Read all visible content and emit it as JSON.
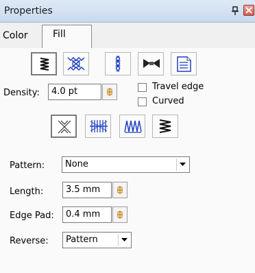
{
  "panel": {
    "title": "Properties",
    "pin_icon": "pin-icon",
    "close_icon": "close-icon"
  },
  "tabs": [
    {
      "label": "Color",
      "active": false
    },
    {
      "label": "Fill",
      "active": true
    }
  ],
  "fill_types": [
    {
      "name": "satin-fill-icon",
      "selected": true
    },
    {
      "name": "cross-pattern-fill-icon",
      "selected": false
    },
    {
      "name": "wave-fill-icon",
      "selected": false
    },
    {
      "name": "bow-tie-fill-icon",
      "selected": false
    },
    {
      "name": "document-fill-icon",
      "selected": false
    }
  ],
  "density": {
    "label": "Density:",
    "value": "4.0 pt"
  },
  "travel_edge": {
    "label": "Travel edge",
    "checked": false
  },
  "curved": {
    "label": "Curved",
    "checked": false
  },
  "stitch_styles": [
    {
      "name": "cross-stitch-icon",
      "selected": true
    },
    {
      "name": "blanket-stitch-icon",
      "selected": false
    },
    {
      "name": "zigzag-stitch-icon",
      "selected": false
    },
    {
      "name": "satin-stitch-icon",
      "selected": false
    }
  ],
  "pattern": {
    "label": "Pattern:",
    "value": "None"
  },
  "length": {
    "label": "Length:",
    "value": "3.5 mm"
  },
  "edge_pad": {
    "label": "Edge Pad:",
    "value": "0.4 mm"
  },
  "reverse": {
    "label": "Reverse:",
    "value": "Pattern"
  },
  "colors": {
    "titlebar": "#c9d9ee",
    "icon_blue": "#1f3fbf",
    "content_bg": "#fafafa"
  }
}
